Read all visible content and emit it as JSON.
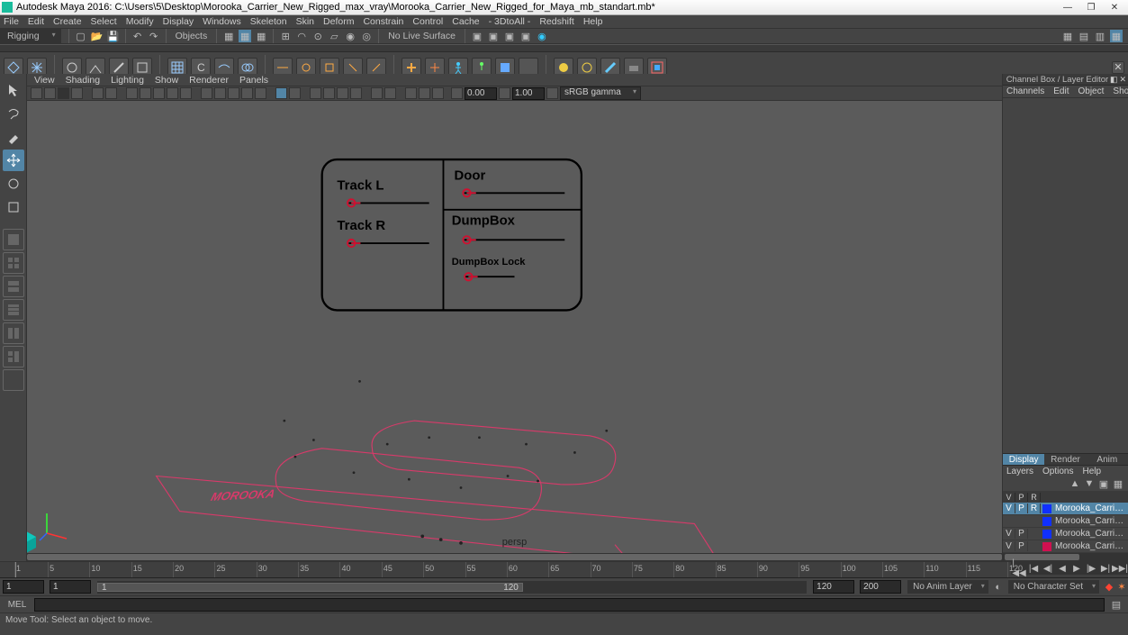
{
  "window": {
    "title": "Autodesk Maya 2016: C:\\Users\\5\\Desktop\\Morooka_Carrier_New_Rigged_max_vray\\Morooka_Carrier_New_Rigged_for_Maya_mb_standart.mb*"
  },
  "menu": {
    "items": [
      "File",
      "Edit",
      "Create",
      "Select",
      "Modify",
      "Display",
      "Windows",
      "Skeleton",
      "Skin",
      "Deform",
      "Constrain",
      "Control",
      "Cache",
      "- 3DtoAll -",
      "Redshift",
      "Help"
    ]
  },
  "status": {
    "mode": "Rigging",
    "no_live_surface": "No Live Surface",
    "objects": "Objects"
  },
  "view_menu": {
    "items": [
      "View",
      "Shading",
      "Lighting",
      "Show",
      "Renderer",
      "Panels"
    ]
  },
  "view_toolbar": {
    "near": "0.00",
    "gamma": "1.00",
    "color_mgmt": "sRGB gamma"
  },
  "viewport": {
    "panel_label": "persp",
    "control_labels": {
      "track_l": "Track L",
      "track_r": "Track R",
      "door": "Door",
      "dumpbox": "DumpBox",
      "dumpbox_lock": "DumpBox Lock"
    }
  },
  "channel_box": {
    "title": "Channel Box / Layer Editor",
    "menu": [
      "Channels",
      "Edit",
      "Object",
      "Show"
    ],
    "layer_tabs": [
      "Display",
      "Render",
      "Anim"
    ],
    "layer_sub": [
      "Layers",
      "Options",
      "Help"
    ],
    "layer_header": {
      "v": "V",
      "p": "P",
      "r": "R"
    },
    "layers": [
      {
        "v": "V",
        "p": "P",
        "r": "R",
        "color": "#1030ff",
        "name": "Morooka_Carrier_New",
        "selected": true
      },
      {
        "v": "",
        "p": "",
        "r": "",
        "color": "#1030ff",
        "name": "Morooka_Carrier_New",
        "selected": false
      },
      {
        "v": "V",
        "p": "P",
        "r": "",
        "color": "#1030ff",
        "name": "Morooka_Carrier_New",
        "selected": false
      },
      {
        "v": "V",
        "p": "P",
        "r": "",
        "color": "#d01050",
        "name": "Morooka_Carrier_New",
        "selected": false
      }
    ]
  },
  "timeline": {
    "ticks": [
      "1",
      "5",
      "10",
      "15",
      "20",
      "25",
      "30",
      "35",
      "40",
      "45",
      "50",
      "55",
      "60",
      "65",
      "70",
      "75",
      "80",
      "85",
      "90",
      "95",
      "100",
      "105",
      "110",
      "115",
      "120"
    ],
    "range_start": "1",
    "range_end": "120",
    "play_start": "1",
    "play_end": "120",
    "anim_start": "1",
    "anim_end": "200",
    "anim_layer": "No Anim Layer",
    "char_set": "No Character Set"
  },
  "command_line": {
    "lang": "MEL"
  },
  "help_line": {
    "text": "Move Tool: Select an object to move."
  }
}
